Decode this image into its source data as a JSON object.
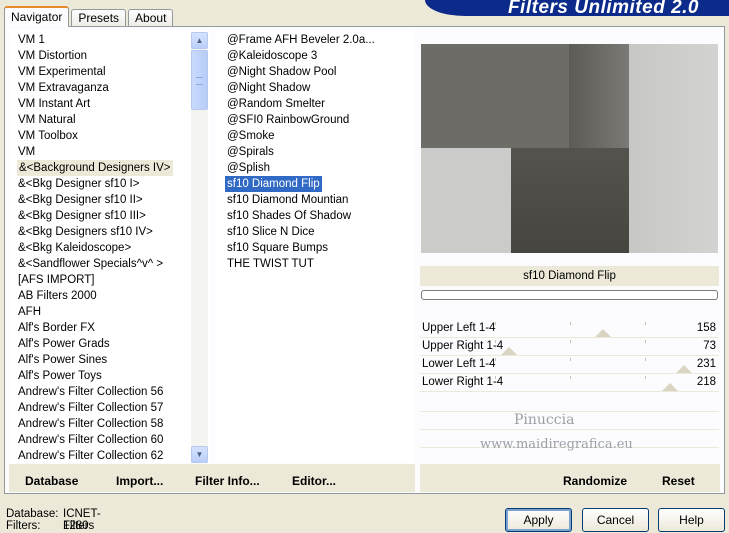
{
  "tabs": [
    "Navigator",
    "Presets",
    "About"
  ],
  "banner": "Filters Unlimited 2.0",
  "categories": [
    "VM 1",
    "VM Distortion",
    "VM Experimental",
    "VM Extravaganza",
    "VM Instant Art",
    "VM Natural",
    "VM Toolbox",
    "VM",
    "&<Background Designers IV>",
    "&<Bkg Designer sf10 I>",
    "&<Bkg Designer sf10 II>",
    "&<Bkg Designer sf10 III>",
    "&<Bkg Designers sf10 IV>",
    "&<Bkg Kaleidoscope>",
    "&<Sandflower Specials^v^ >",
    "[AFS IMPORT]",
    "AB Filters 2000",
    "AFH",
    "Alf's Border FX",
    "Alf's Power Grads",
    "Alf's Power Sines",
    "Alf's Power Toys",
    "Andrew's Filter Collection 56",
    "Andrew's Filter Collection 57",
    "Andrew's Filter Collection 58",
    "Andrew's Filter Collection 60",
    "Andrew's Filter Collection 62"
  ],
  "highlighted_category": "&<Background Designers IV>",
  "filters": [
    "@Frame AFH Beveler 2.0a...",
    "@Kaleidoscope 3",
    "@Night Shadow Pool",
    "@Night Shadow",
    "@Random Smelter",
    "@SFI0 RainbowGround",
    "@Smoke",
    "@Spirals",
    "@Splish",
    "sf10 Diamond Flip",
    "sf10 Diamond Mountian",
    "sf10 Shades Of Shadow",
    "sf10 Slice N Dice",
    "sf10 Square Bumps",
    "THE TWIST TUT"
  ],
  "selected_filter": "sf10 Diamond Flip",
  "left_buttons": {
    "database": "Database",
    "import": "Import...",
    "filter_info": "Filter Info...",
    "editor": "Editor..."
  },
  "filter_name": "sf10 Diamond Flip",
  "progress": 0,
  "sliders": [
    {
      "label": "Upper Left 1-4",
      "value": 158
    },
    {
      "label": "Upper Right 1-4",
      "value": 73
    },
    {
      "label": "Lower Left 1-4",
      "value": 231
    },
    {
      "label": "Lower Right 1-4",
      "value": 218
    }
  ],
  "right_buttons": {
    "randomize": "Randomize",
    "reset": "Reset"
  },
  "watermark": {
    "line1": "Pinuccia",
    "line2": "www.maidiregrafica.eu"
  },
  "status": {
    "database_label": "Database:",
    "database_value": "ICNET-Filters",
    "filters_label": "Filters:",
    "filters_value": "1280"
  },
  "dialog_buttons": {
    "apply": "Apply",
    "cancel": "Cancel",
    "help": "Help"
  },
  "colors": {
    "selection": "#316ac5",
    "banner": "#0b2a8a",
    "face": "#ece9d8"
  }
}
